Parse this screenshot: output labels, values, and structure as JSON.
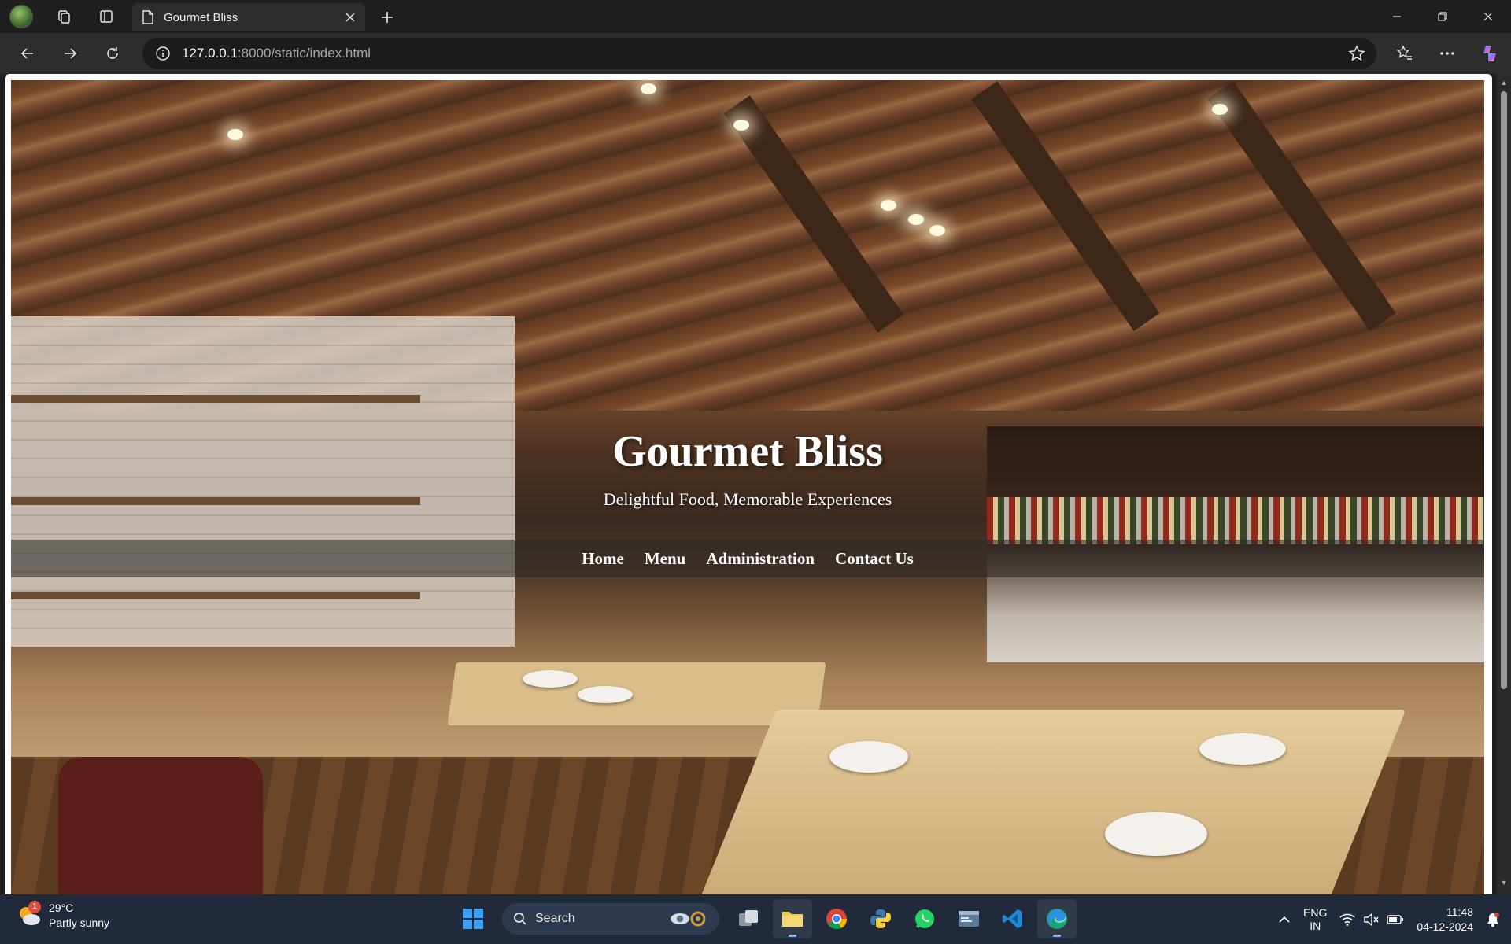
{
  "browser": {
    "tab": {
      "title": "Gourmet Bliss",
      "icon": "page-icon"
    },
    "url": {
      "host": "127.0.0.1",
      "rest": ":8000/static/index.html"
    }
  },
  "site": {
    "title": "Gourmet Bliss",
    "subtitle": "Delightful Food, Memorable Experiences",
    "nav": [
      {
        "label": "Home"
      },
      {
        "label": "Menu"
      },
      {
        "label": "Administration"
      },
      {
        "label": "Contact Us"
      }
    ]
  },
  "taskbar": {
    "weather": {
      "temp": "29°C",
      "condition": "Partly sunny",
      "badge": "1"
    },
    "search_label": "Search",
    "language": {
      "line1": "ENG",
      "line2": "IN"
    },
    "time": "11:48",
    "date": "04-12-2024"
  }
}
